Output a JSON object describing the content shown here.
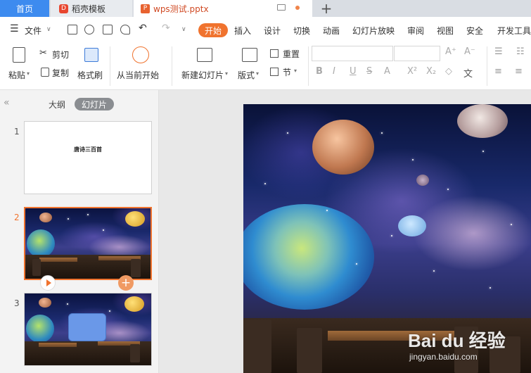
{
  "tabs": {
    "home": "首页",
    "templates": "稻壳模板",
    "document": "wps测试.pptx"
  },
  "menu": {
    "file": "文件",
    "items": [
      "开始",
      "插入",
      "设计",
      "切换",
      "动画",
      "幻灯片放映",
      "审阅",
      "视图",
      "安全",
      "开发工具"
    ]
  },
  "ribbon": {
    "paste": "粘贴",
    "cut": "剪切",
    "copy": "复制",
    "format_painter": "格式刷",
    "from_current": "从当前开始",
    "new_slide": "新建幻灯片",
    "layout": "版式",
    "reset": "重置",
    "section": "节"
  },
  "panel": {
    "outline": "大纲",
    "slides": "幻灯片"
  },
  "slides": [
    {
      "number": "1",
      "title": "唐诗三百首"
    },
    {
      "number": "2"
    },
    {
      "number": "3"
    }
  ],
  "watermark": {
    "brand": "Bai du 经验",
    "url": "jingyan.baidu.com"
  },
  "colors": {
    "accent": "#f0732e",
    "home_tab": "#3d8bef"
  }
}
